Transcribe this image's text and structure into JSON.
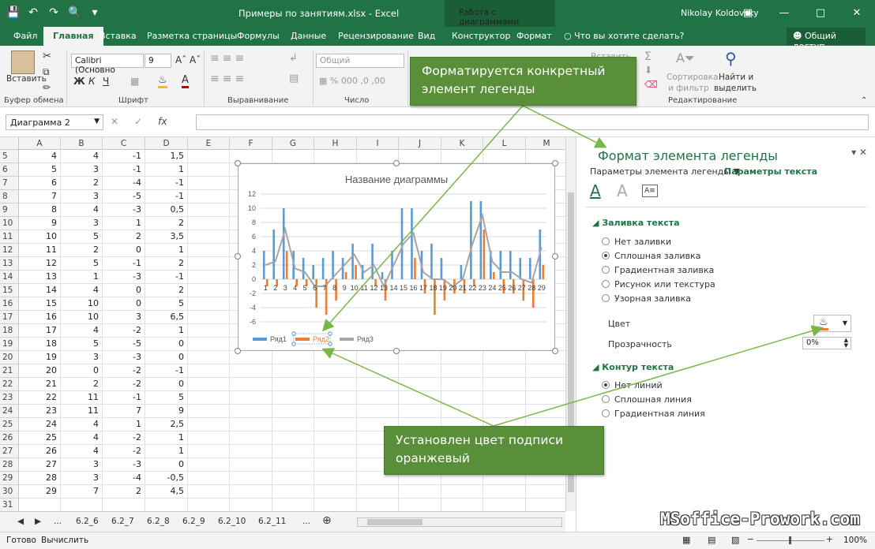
{
  "window": {
    "title": "Примеры по занятиям.xlsx - Excel",
    "context_tab_group": "Работа с диаграммами",
    "user": "Nikolay Koldovsky",
    "share": "Общий доступ"
  },
  "tabs": [
    "Файл",
    "Главная",
    "Вставка",
    "Разметка страницы",
    "Формулы",
    "Данные",
    "Рецензирование",
    "Вид",
    "Конструктор",
    "Формат"
  ],
  "tell_me": "Что вы хотите сделать?",
  "ribbon": {
    "paste": "Вставить",
    "font_name": "Calibri (Основно",
    "font_size": "9",
    "number_format": "Общий",
    "insert": "Вставить",
    "sort_filter_1": "Сортировка",
    "sort_filter_2": "и фильтр",
    "find_1": "Найти и",
    "find_2": "выделить",
    "groups": {
      "clipboard": "Буфер обмена",
      "font": "Шрифт",
      "alignment": "Выравнивание",
      "number": "Число",
      "editing": "Редактирование"
    }
  },
  "formula_bar": {
    "name_box": "Диаграмма 2",
    "fx": "fx"
  },
  "columns": [
    "A",
    "B",
    "C",
    "D",
    "E",
    "F",
    "G",
    "H",
    "I",
    "J",
    "K",
    "L",
    "M"
  ],
  "rows": [
    {
      "n": "5",
      "a": "4",
      "b": "4",
      "c": "-1",
      "d": "1,5"
    },
    {
      "n": "6",
      "a": "5",
      "b": "3",
      "c": "-1",
      "d": "1"
    },
    {
      "n": "7",
      "a": "6",
      "b": "2",
      "c": "-4",
      "d": "-1"
    },
    {
      "n": "8",
      "a": "7",
      "b": "3",
      "c": "-5",
      "d": "-1"
    },
    {
      "n": "9",
      "a": "8",
      "b": "4",
      "c": "-3",
      "d": "0,5"
    },
    {
      "n": "10",
      "a": "9",
      "b": "3",
      "c": "1",
      "d": "2"
    },
    {
      "n": "11",
      "a": "10",
      "b": "5",
      "c": "2",
      "d": "3,5"
    },
    {
      "n": "12",
      "a": "11",
      "b": "2",
      "c": "0",
      "d": "1"
    },
    {
      "n": "13",
      "a": "12",
      "b": "5",
      "c": "-1",
      "d": "2"
    },
    {
      "n": "14",
      "a": "13",
      "b": "1",
      "c": "-3",
      "d": "-1"
    },
    {
      "n": "15",
      "a": "14",
      "b": "4",
      "c": "0",
      "d": "2"
    },
    {
      "n": "16",
      "a": "15",
      "b": "10",
      "c": "0",
      "d": "5"
    },
    {
      "n": "17",
      "a": "16",
      "b": "10",
      "c": "3",
      "d": "6,5"
    },
    {
      "n": "18",
      "a": "17",
      "b": "4",
      "c": "-2",
      "d": "1"
    },
    {
      "n": "19",
      "a": "18",
      "b": "5",
      "c": "-5",
      "d": "0"
    },
    {
      "n": "20",
      "a": "19",
      "b": "3",
      "c": "-3",
      "d": "0"
    },
    {
      "n": "21",
      "a": "20",
      "b": "0",
      "c": "-2",
      "d": "-1"
    },
    {
      "n": "22",
      "a": "21",
      "b": "2",
      "c": "-2",
      "d": "0"
    },
    {
      "n": "23",
      "a": "22",
      "b": "11",
      "c": "-1",
      "d": "5"
    },
    {
      "n": "24",
      "a": "23",
      "b": "11",
      "c": "7",
      "d": "9"
    },
    {
      "n": "25",
      "a": "24",
      "b": "4",
      "c": "1",
      "d": "2,5"
    },
    {
      "n": "26",
      "a": "25",
      "b": "4",
      "c": "-2",
      "d": "1"
    },
    {
      "n": "27",
      "a": "26",
      "b": "4",
      "c": "-2",
      "d": "1"
    },
    {
      "n": "28",
      "a": "27",
      "b": "3",
      "c": "-3",
      "d": "0"
    },
    {
      "n": "29",
      "a": "28",
      "b": "3",
      "c": "-4",
      "d": "-0,5"
    },
    {
      "n": "30",
      "a": "29",
      "b": "7",
      "c": "2",
      "d": "4,5"
    },
    {
      "n": "31",
      "a": "",
      "b": "",
      "c": "",
      "d": ""
    }
  ],
  "chart_data": {
    "type": "bar",
    "title": "Название диаграммы",
    "categories": [
      "1",
      "2",
      "3",
      "4",
      "5",
      "6",
      "7",
      "8",
      "9",
      "10",
      "11",
      "12",
      "13",
      "14",
      "15",
      "16",
      "17",
      "18",
      "19",
      "20",
      "21",
      "22",
      "23",
      "24",
      "25",
      "26",
      "27",
      "28",
      "29"
    ],
    "series": [
      {
        "name": "Ряд1",
        "type": "bar",
        "color": "#5b9bd5",
        "values": [
          4,
          7,
          10,
          4,
          3,
          2,
          3,
          4,
          3,
          5,
          2,
          5,
          1,
          4,
          10,
          10,
          4,
          5,
          3,
          0,
          2,
          11,
          11,
          4,
          4,
          4,
          3,
          3,
          7
        ]
      },
      {
        "name": "Ряд2",
        "type": "bar",
        "color": "#ed7d31",
        "values": [
          -1,
          -1,
          4,
          -1,
          -1,
          -4,
          -5,
          -3,
          1,
          2,
          0,
          -1,
          -3,
          0,
          0,
          3,
          -2,
          -5,
          -3,
          -2,
          -2,
          -1,
          7,
          1,
          -2,
          -2,
          -3,
          -4,
          2
        ]
      },
      {
        "name": "Ряд3",
        "type": "line",
        "color": "#a5a5a5",
        "values": [
          2,
          2.5,
          7,
          1.5,
          1,
          -1,
          -1,
          0.5,
          2,
          3.5,
          1,
          2,
          -1,
          2,
          5,
          6.5,
          1,
          0,
          0,
          -1,
          0,
          5,
          9,
          2.5,
          1,
          1,
          0,
          -0.5,
          4.5
        ]
      }
    ],
    "ylim": [
      -6,
      12
    ],
    "yticks": [
      "12",
      "10",
      "8",
      "6",
      "4",
      "2",
      "0",
      "-2",
      "-4",
      "-6"
    ],
    "legend": "bottom"
  },
  "sheet_tabs": [
    "...",
    "6.2_6",
    "6.2_7",
    "6.2_8",
    "6.2_9",
    "6.2_10",
    "6.2_11",
    "..."
  ],
  "status": {
    "ready": "Готово",
    "calc": "Вычислить",
    "zoom": "100%"
  },
  "pane": {
    "title": "Формат элемента легенды",
    "tab_legend_options": "Параметры элемента легенды",
    "tab_text_options": "Параметры текста",
    "fill_section": "Заливка текста",
    "fill_options": [
      {
        "label": "Нет заливки",
        "on": false
      },
      {
        "label": "Сплошная заливка",
        "on": true
      },
      {
        "label": "Градиентная заливка",
        "on": false
      },
      {
        "label": "Рисунок или текстура",
        "on": false
      },
      {
        "label": "Узорная заливка",
        "on": false
      }
    ],
    "color_label": "Цвет",
    "transparency_label": "Прозрачность",
    "transparency_value": "0%",
    "outline_section": "Контур текста",
    "outline_options": [
      {
        "label": "Нет линий",
        "on": true
      },
      {
        "label": "Сплошная линия",
        "on": false
      },
      {
        "label": "Градиентная линия",
        "on": false
      }
    ]
  },
  "callouts": {
    "top": "Форматируется конкретный элемент легенды",
    "bottom": "Установлен цвет подписи оранжевый"
  },
  "watermark": "MSoffice-Prowork.com",
  "colors": {
    "excel_green": "#217346",
    "callout": "#5a8f3a",
    "orange": "#ed7d31",
    "blue": "#5b9bd5",
    "gray": "#a5a5a5"
  }
}
